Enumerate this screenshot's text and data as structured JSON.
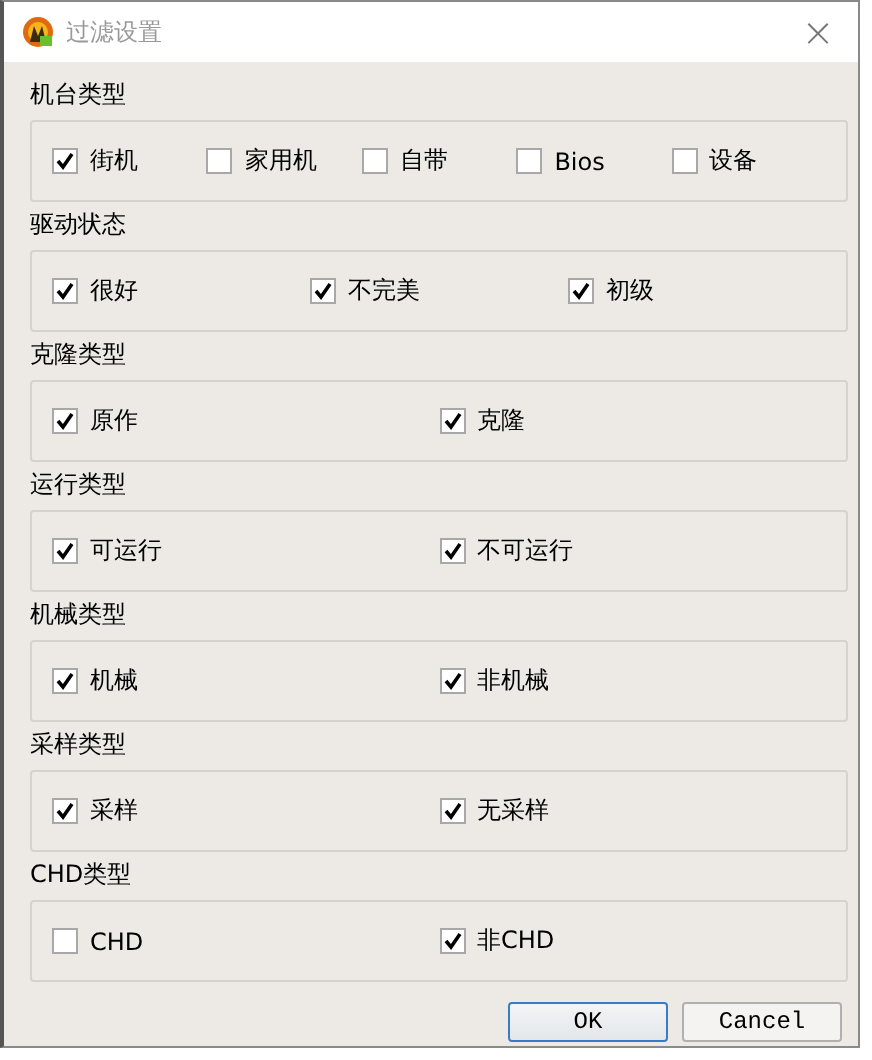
{
  "window": {
    "title": "过滤设置",
    "close": "×"
  },
  "groups": [
    {
      "label": "机台类型",
      "options": [
        {
          "label": "街机",
          "checked": true
        },
        {
          "label": "家用机",
          "checked": false
        },
        {
          "label": "自带",
          "checked": false
        },
        {
          "label": "Bios",
          "checked": false
        },
        {
          "label": "设备",
          "checked": false
        }
      ]
    },
    {
      "label": "驱动状态",
      "options": [
        {
          "label": "很好",
          "checked": true
        },
        {
          "label": "不完美",
          "checked": true
        },
        {
          "label": "初级",
          "checked": true
        }
      ]
    },
    {
      "label": "克隆类型",
      "options": [
        {
          "label": "原作",
          "checked": true
        },
        {
          "label": "克隆",
          "checked": true
        }
      ]
    },
    {
      "label": "运行类型",
      "options": [
        {
          "label": "可运行",
          "checked": true
        },
        {
          "label": "不可运行",
          "checked": true
        }
      ]
    },
    {
      "label": "机械类型",
      "options": [
        {
          "label": "机械",
          "checked": true
        },
        {
          "label": "非机械",
          "checked": true
        }
      ]
    },
    {
      "label": "采样类型",
      "options": [
        {
          "label": "采样",
          "checked": true
        },
        {
          "label": "无采样",
          "checked": true
        }
      ]
    },
    {
      "label": "CHD类型",
      "options": [
        {
          "label": "CHD",
          "checked": false
        },
        {
          "label": "非CHD",
          "checked": true
        }
      ]
    }
  ],
  "buttons": [
    {
      "label": "OK",
      "default": true
    },
    {
      "label": "Cancel",
      "default": false
    }
  ]
}
